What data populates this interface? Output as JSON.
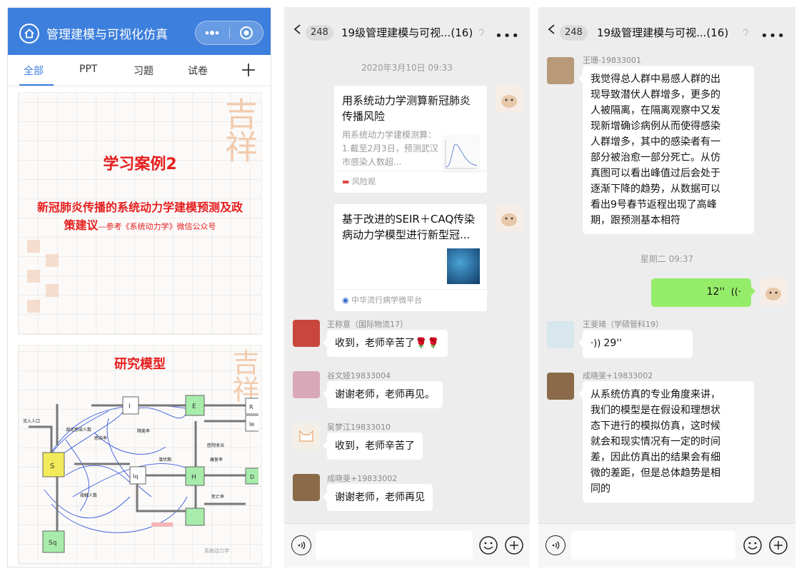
{
  "screen1": {
    "title": "管理建模与可视化仿真",
    "tabs": [
      {
        "label": "全部"
      },
      {
        "label": "PPT"
      },
      {
        "label": "习题"
      },
      {
        "label": "试卷"
      }
    ],
    "slide1": {
      "title": "学习案例2",
      "subtitle": "新冠肺炎传播的系统动力学建模预测及政策建议",
      "subtitle_ref": "—参考《系统动力学》微信公众号"
    },
    "slide2": {
      "title": "研究模型",
      "nodes": {
        "S": "S",
        "I": "I",
        "Iq": "Iq",
        "Sq": "Sq",
        "H": "H",
        "D": "D",
        "R": "R",
        "Ie": "Ie",
        "E": "E"
      },
      "labels": {
        "hb_exposed": "湖北感染人数",
        "infected_rate": "感染率",
        "quarantine": "隔离率",
        "hospital": "医院收治",
        "recover": "康复率",
        "death": "死亡率",
        "contact": "接触人数",
        "latent": "潜伏期",
        "in_flow": "流入人口"
      },
      "watermark": "系统动力学"
    }
  },
  "screen2": {
    "back_count": "248",
    "title": "19级管理建模与可视...(16)",
    "time": "2020年3月10日 09:33",
    "card1": {
      "title": "用系统动力学测算新冠肺炎传播风险",
      "desc": "用系统动力学建模测算：1.截至2月3日，预测武汉市感染人数超...",
      "source": "风险观"
    },
    "card2": {
      "title": "基于改进的SEIR＋CAQ传染病动力学模型进行新型冠...",
      "source": "中华流行病学微平台"
    },
    "messages": [
      {
        "sender": "王称意（国际物流17）",
        "text": "收到，老师辛苦了🌹🌹"
      },
      {
        "sender": "谷文娅19833004",
        "text": "谢谢老师，老师再见。"
      },
      {
        "sender": "吴梦江19833010",
        "text": "收到，老师辛苦了"
      },
      {
        "sender": "成晓斐+19833002",
        "text": "谢谢老师，老师再见"
      }
    ]
  },
  "screen3": {
    "back_count": "248",
    "title": "19级管理建模与可视...(16)",
    "msg1": {
      "sender": "王珊-19833001",
      "lines": [
        "我觉得总人群中易感人群的出",
        "现导致潜伏人群增多，更多的",
        "人被隔离，在隔离观察中又发",
        "现新增确诊病例从而使得感染",
        "人群增多，其中的感染者有一",
        "部分被治愈一部分死亡。从仿",
        "真图可以看出峰值过后会处于",
        "逐渐下降的趋势，从数据可以",
        "看出9号春节返程出现了高峰",
        "期，跟预测基本相符"
      ]
    },
    "time": "星期二 09:37",
    "voice_self": "12''",
    "msg2": {
      "sender": "王斐琦（学硕管科19）",
      "voice": "29''"
    },
    "msg3": {
      "sender": "成晓斐+19833002",
      "lines": [
        "从系统仿真的专业角度来讲，",
        "我们的模型是在假设和理想状",
        "态下进行的模拟仿真，这时候",
        "就会和现实情况有一定的时间",
        "差，因此仿真出的结果会有细",
        "微的差距，但是总体趋势是相",
        "同的"
      ]
    }
  }
}
